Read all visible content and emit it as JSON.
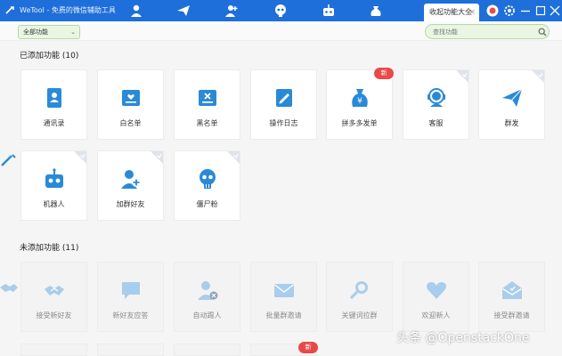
{
  "titlebar": {
    "app_title": "WeTool - 免费的微信辅助工具",
    "collapse_tab_label": "收起功能大全",
    "collapse_tab_close": "×"
  },
  "toolbar": {
    "filter_value": "全部功能",
    "search_placeholder": "查找功能"
  },
  "added_section": {
    "title": "已添加功能 (10)",
    "cards": [
      {
        "label": "通讯录",
        "icon": "contacts-book-icon"
      },
      {
        "label": "白名单",
        "icon": "whitelist-icon"
      },
      {
        "label": "黑名单",
        "icon": "blacklist-icon"
      },
      {
        "label": "操作日志",
        "icon": "operation-log-icon"
      },
      {
        "label": "拼多多发单",
        "icon": "money-bag-icon",
        "badge": "新"
      },
      {
        "label": "客服",
        "icon": "customer-service-icon"
      },
      {
        "label": "群发",
        "icon": "paper-plane-icon"
      },
      {
        "label": "机器人",
        "icon": "robot-icon"
      },
      {
        "label": "加群好友",
        "icon": "add-friend-icon"
      },
      {
        "label": "僵尸粉",
        "icon": "skull-icon"
      }
    ]
  },
  "unadded_section": {
    "title": "未添加功能 (11)",
    "cards": [
      {
        "label": "接受新好友",
        "icon": "handshake-icon"
      },
      {
        "label": "新好友应答",
        "icon": "chat-bubble-icon"
      },
      {
        "label": "自动踢人",
        "icon": "kick-user-icon"
      },
      {
        "label": "批量群邀请",
        "icon": "envelope-icon"
      },
      {
        "label": "关键词拉群",
        "icon": "magnifier-icon"
      },
      {
        "label": "欢迎新人",
        "icon": "heart-icon"
      },
      {
        "label": "接受群邀请",
        "icon": "open-envelope-icon"
      }
    ],
    "partial_badge": "新"
  },
  "watermark": "头条 @OpenstackOne",
  "colors": {
    "titlebar": "#1e6fd9",
    "icon_active": "#2a8ad6",
    "icon_disabled": "#a9cdec",
    "new_badge": "#e84a4a"
  }
}
